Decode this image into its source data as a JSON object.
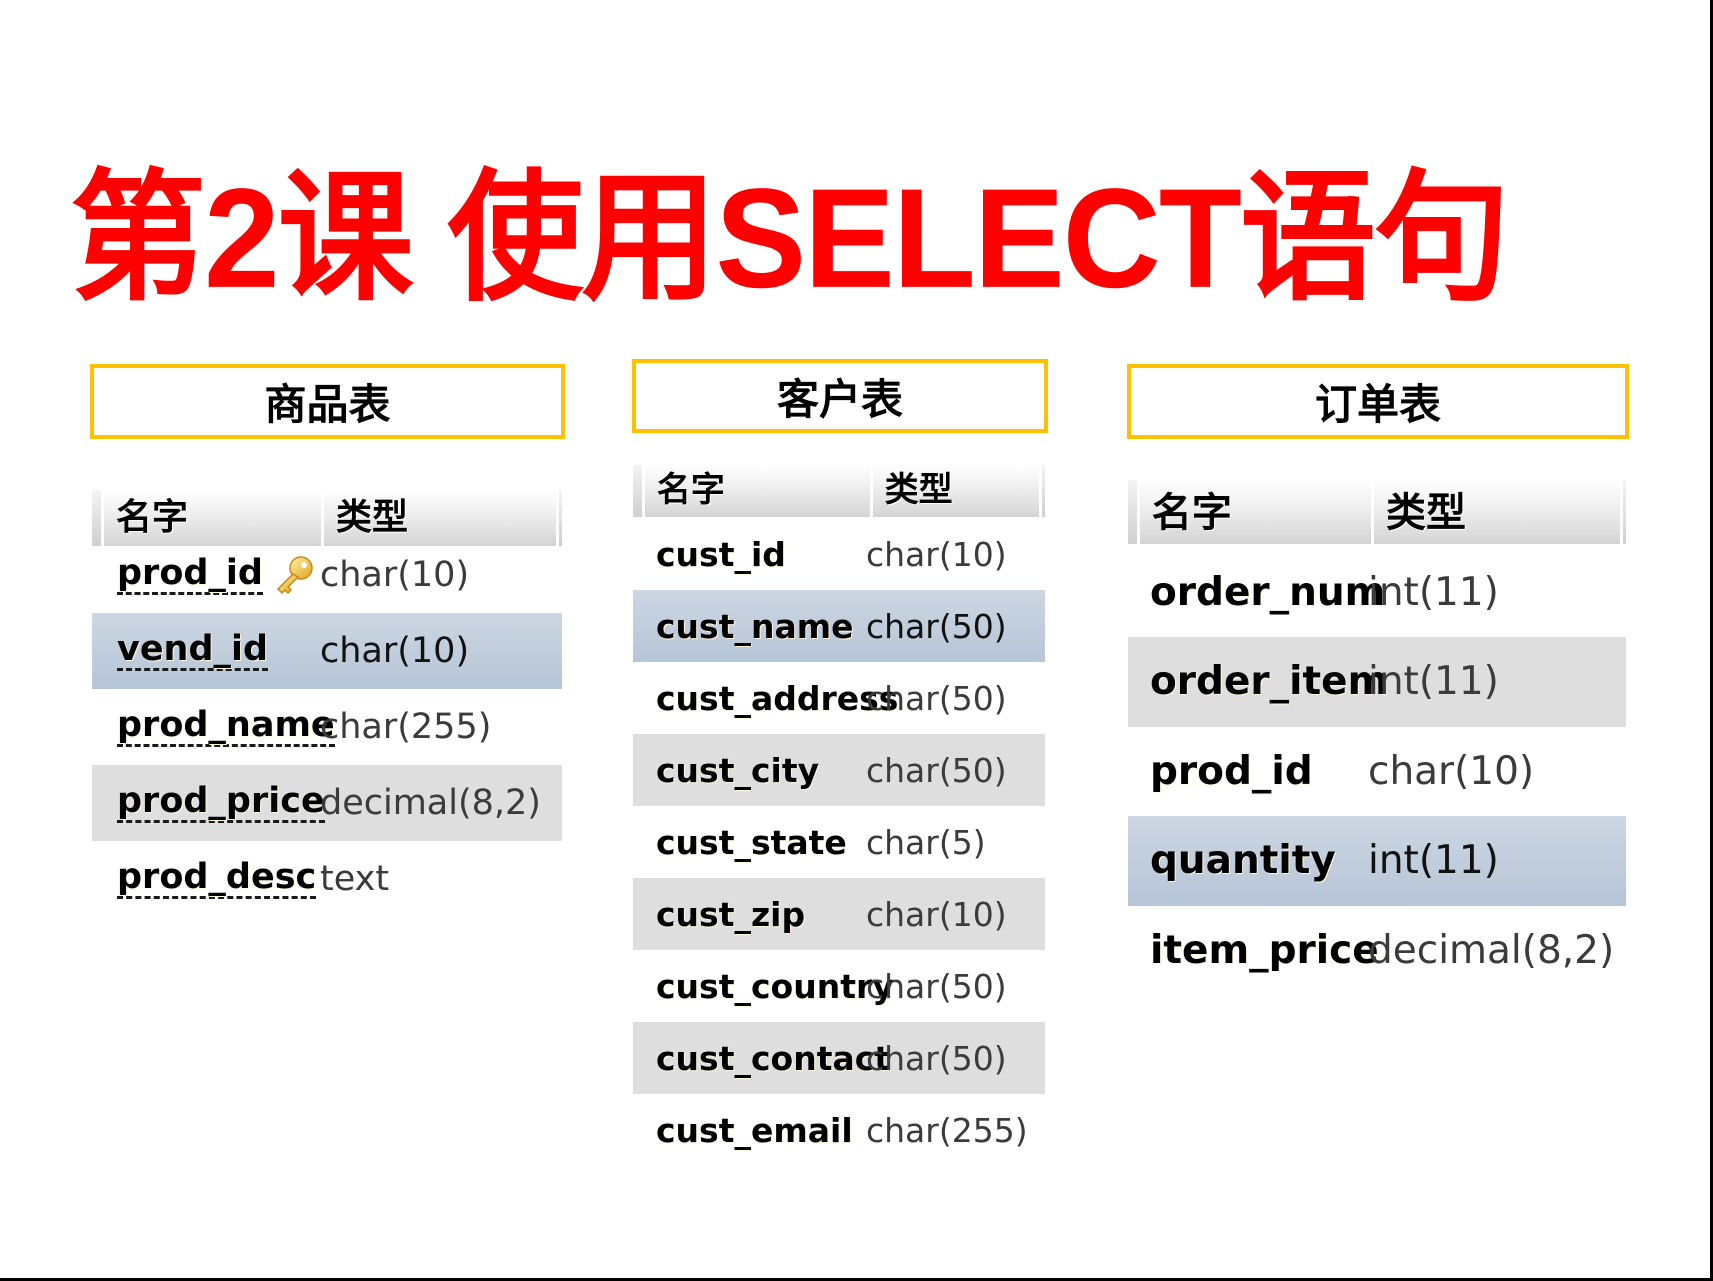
{
  "title": "第2课 使用SELECT语句",
  "colors": {
    "title": "#ff0000",
    "title_box_border": "#ffc000",
    "alt_row": "#dedede",
    "selected_row": "#c2cedd"
  },
  "tables": [
    {
      "title": "商品表",
      "header": {
        "name": "名字",
        "type": "类型"
      },
      "rows": [
        {
          "name": "prod_id",
          "type": "char(10)",
          "style": "plain",
          "icon": "key-icon"
        },
        {
          "name": "vend_id",
          "type": "char(10)",
          "style": "selected"
        },
        {
          "name": "prod_name",
          "type": "char(255)",
          "style": "plain"
        },
        {
          "name": "prod_price",
          "type": "decimal(8,2)",
          "style": "alt"
        },
        {
          "name": "prod_desc",
          "type": "text",
          "style": "plain"
        }
      ]
    },
    {
      "title": "客户表",
      "header": {
        "name": "名字",
        "type": "类型"
      },
      "rows": [
        {
          "name": "cust_id",
          "type": "char(10)",
          "style": "plain"
        },
        {
          "name": "cust_name",
          "type": "char(50)",
          "style": "selected"
        },
        {
          "name": "cust_address",
          "type": "char(50)",
          "style": "plain"
        },
        {
          "name": "cust_city",
          "type": "char(50)",
          "style": "alt"
        },
        {
          "name": "cust_state",
          "type": "char(5)",
          "style": "plain"
        },
        {
          "name": "cust_zip",
          "type": "char(10)",
          "style": "alt"
        },
        {
          "name": "cust_country",
          "type": "char(50)",
          "style": "plain"
        },
        {
          "name": "cust_contact",
          "type": "char(50)",
          "style": "alt"
        },
        {
          "name": "cust_email",
          "type": "char(255)",
          "style": "plain"
        }
      ]
    },
    {
      "title": "订单表",
      "header": {
        "name": "名字",
        "type": "类型"
      },
      "rows": [
        {
          "name": "order_num",
          "type": "int(11)",
          "style": "plain"
        },
        {
          "name": "order_item",
          "type": "int(11)",
          "style": "alt"
        },
        {
          "name": "prod_id",
          "type": "char(10)",
          "style": "plain"
        },
        {
          "name": "quantity",
          "type": "int(11)",
          "style": "selected"
        },
        {
          "name": "item_price",
          "type": "decimal(8,2)",
          "style": "plain"
        }
      ]
    }
  ]
}
